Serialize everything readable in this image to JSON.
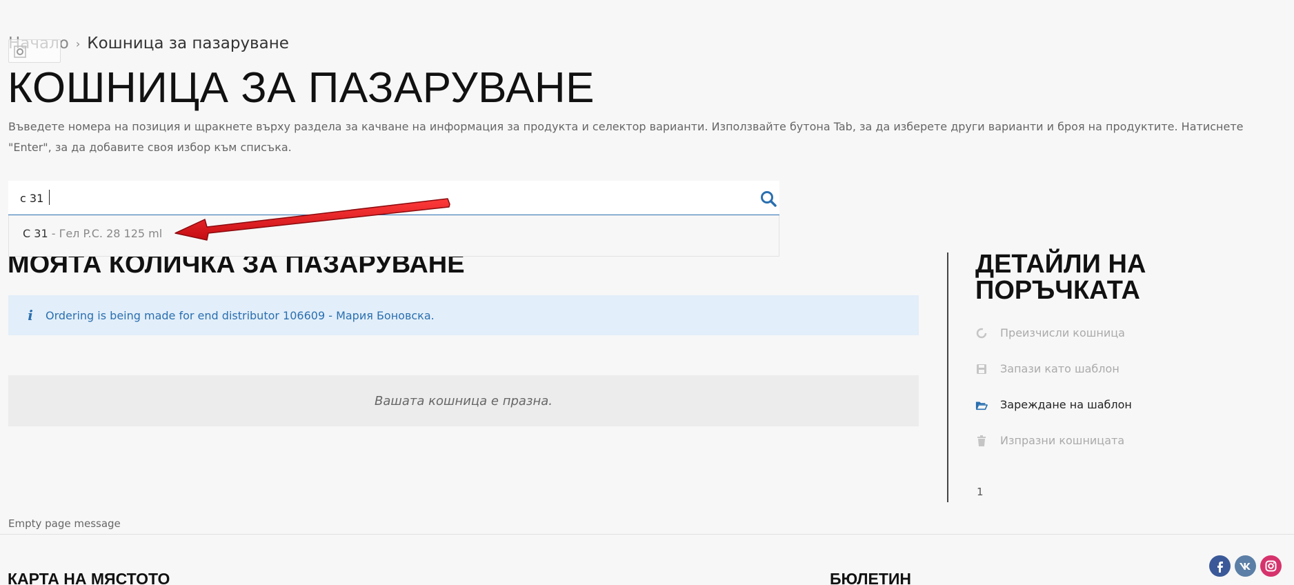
{
  "breadcrumb": {
    "home": "Начало",
    "separator": "›",
    "current": "Кошница за пазаруване"
  },
  "page_title": "КОШНИЦА ЗА ПАЗАРУВАНЕ",
  "intro_text": "Въведете номера на позиция и щракнете върху раздела за качване на информация за продукта и селектор варианти. Използвайте бутона Tab, за да изберете други варианти и броя на продуктите. Натиснете \"Enter\", за да добавите своя избор към списъка.",
  "search": {
    "value": "c 31",
    "icon": "search-icon"
  },
  "suggestions": [
    {
      "code": "C 31",
      "description": " - Гел P.C. 28 125 ml"
    }
  ],
  "cart": {
    "title": "МОЯТА КОЛИЧКА ЗА ПАЗАРУВАНЕ",
    "info_message": "Ordering is being made for end distributor 106609 - Мария Боновска.",
    "empty_message": "Вашата кошница е празна."
  },
  "order_details": {
    "title": "ДЕТАЙЛИ НА ПОРЪЧКАТА",
    "actions": [
      {
        "label": "Преизчисли кошница",
        "icon": "refresh-icon",
        "enabled": false
      },
      {
        "label": "Запази като шаблон",
        "icon": "floppy-disk-icon",
        "enabled": false
      },
      {
        "label": "Зареждане на шаблон",
        "icon": "folder-open-icon",
        "enabled": true
      },
      {
        "label": "Изпразни кошницата",
        "icon": "trash-icon",
        "enabled": false
      }
    ],
    "page_number": "1"
  },
  "empty_page_message": "Empty page message",
  "footer": {
    "sitemap_heading": "КАРТА НА МЯСТОТО",
    "newsletter_heading": "БЮЛЕТИН"
  },
  "colors": {
    "accent": "#2a6fb0",
    "info_background": "#e2eef9",
    "arrow": "#e0141c"
  }
}
